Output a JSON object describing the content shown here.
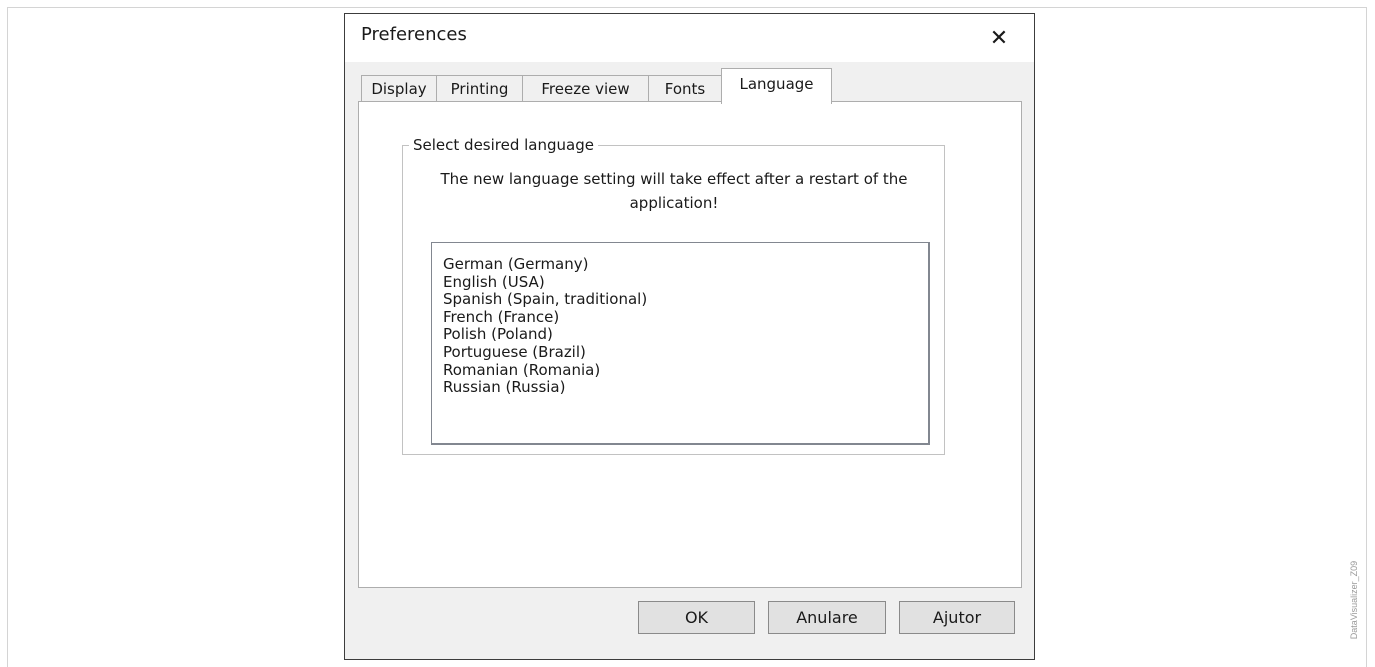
{
  "dialog": {
    "title": "Preferences",
    "close_glyph": "✕"
  },
  "tabs": [
    {
      "label": "Display",
      "active": false
    },
    {
      "label": "Printing",
      "active": false
    },
    {
      "label": "Freeze view",
      "active": false
    },
    {
      "label": "Fonts",
      "active": false
    },
    {
      "label": "Language",
      "active": true
    }
  ],
  "language_panel": {
    "group_title": "Select desired language",
    "message": "The new language setting will take effect after a restart of the application!",
    "languages": [
      "German (Germany)",
      "English (USA)",
      "Spanish (Spain, traditional)",
      "French (France)",
      "Polish (Poland)",
      "Portuguese (Brazil)",
      "Romanian (Romania)",
      "Russian (Russia)"
    ]
  },
  "buttons": {
    "ok": "OK",
    "cancel": "Anulare",
    "help": "Ajutor"
  },
  "figure_caption": "DataVisualizer_Z09"
}
